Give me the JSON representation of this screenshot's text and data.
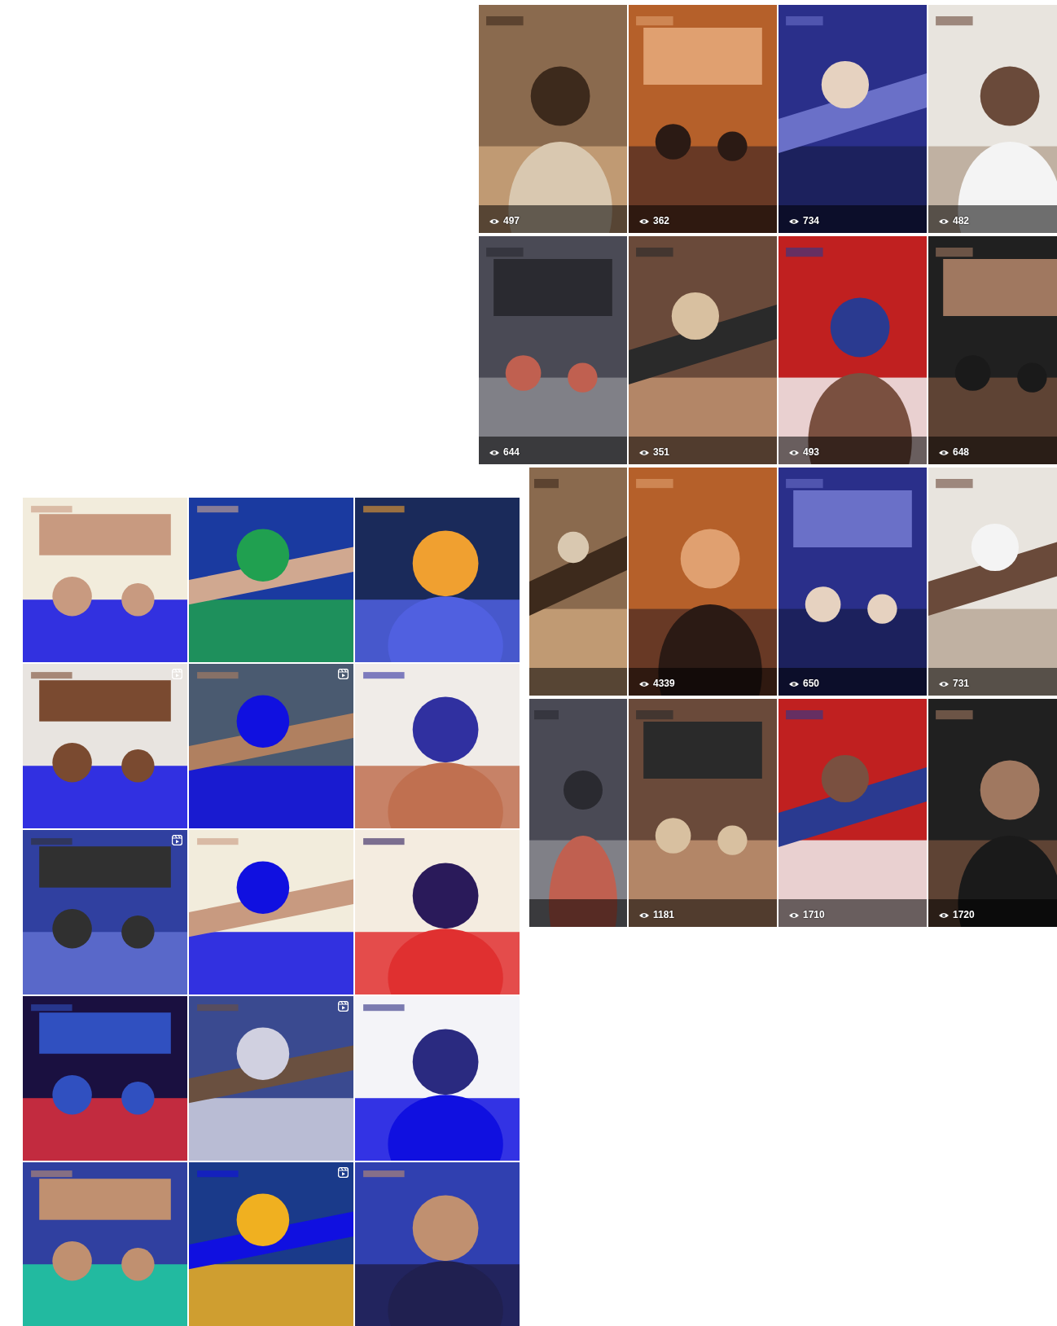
{
  "video_grid": {
    "rows": [
      [
        {
          "kind": "video",
          "views": "497"
        },
        {
          "kind": "video",
          "views": "362"
        },
        {
          "kind": "video",
          "views": "734"
        },
        {
          "kind": "video",
          "views": "482"
        }
      ],
      [
        {
          "kind": "video",
          "views": "644"
        },
        {
          "kind": "video",
          "views": "351"
        },
        {
          "kind": "video",
          "views": "493"
        },
        {
          "kind": "video",
          "views": "648"
        }
      ],
      [
        {
          "kind": "picture"
        },
        {
          "kind": "video",
          "views": "4339"
        },
        {
          "kind": "video",
          "views": "650"
        },
        {
          "kind": "video",
          "views": "731"
        }
      ],
      [
        {
          "kind": "picture"
        },
        {
          "kind": "video",
          "views": "1181"
        },
        {
          "kind": "video",
          "views": "1710"
        },
        {
          "kind": "video",
          "views": "1720"
        }
      ]
    ]
  },
  "post_grid": {
    "posts": [
      {
        "reel": false
      },
      {
        "reel": false
      },
      {
        "reel": false
      },
      {
        "reel": true
      },
      {
        "reel": true
      },
      {
        "reel": false
      },
      {
        "reel": true
      },
      {
        "reel": false
      },
      {
        "reel": false
      },
      {
        "reel": false
      },
      {
        "reel": true
      },
      {
        "reel": false
      },
      {
        "reel": false
      },
      {
        "reel": true
      },
      {
        "reel": false
      }
    ]
  }
}
